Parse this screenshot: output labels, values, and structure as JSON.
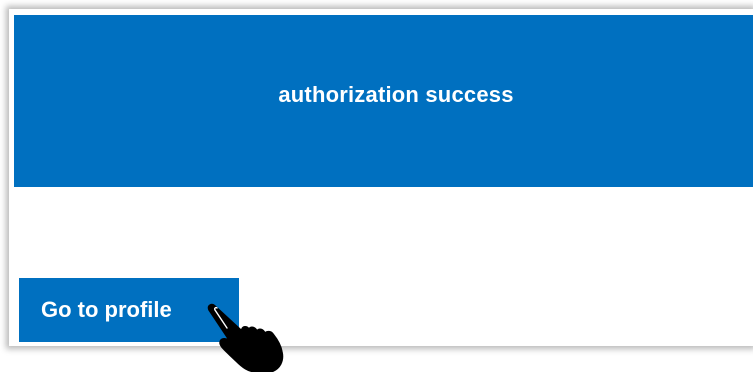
{
  "banner": {
    "title": "authorization success",
    "color": "#0070c0"
  },
  "actions": {
    "profile_button_label": "Go to profile"
  },
  "cursor": {
    "icon": "pointing-hand-cursor-icon"
  }
}
